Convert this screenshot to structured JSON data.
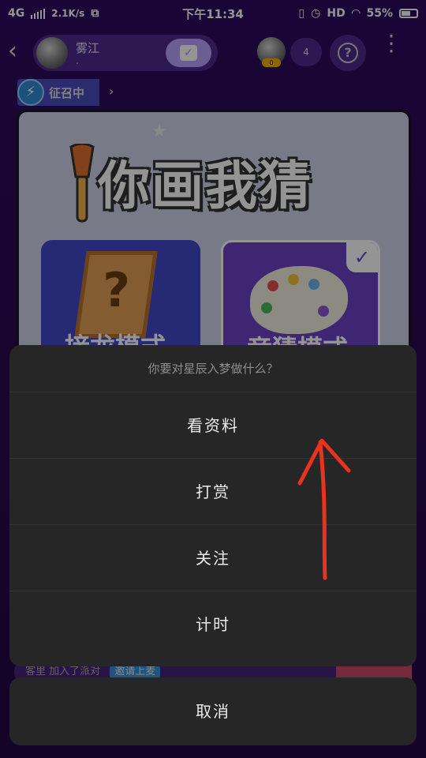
{
  "status_bar": {
    "network": "4G",
    "speed": "2.1K/s",
    "time": "下午11:34",
    "hd": "HD",
    "battery": "55%"
  },
  "room": {
    "back_icon": "chevron-left-icon",
    "host_name": "雾江",
    "host_sub": ".",
    "viewer_level": "0",
    "online_count": "4",
    "recruit_label": "征召中",
    "recruit_arrow": "›"
  },
  "game": {
    "title": "你画我猜",
    "mode_relay": "接龙模式",
    "mode_guess": "竞猜模式"
  },
  "background_lower": {
    "text": "客里 加入了派对",
    "invite": "邀请上麦"
  },
  "action_sheet": {
    "title": "你要对星辰入梦做什么？",
    "items": [
      "看资料",
      "打赏",
      "关注",
      "计时"
    ],
    "cancel": "取消"
  },
  "colors": {
    "sheet_bg": "#262626",
    "annotation_arrow": "#e8331f",
    "app_bg": "#2a0a55"
  }
}
